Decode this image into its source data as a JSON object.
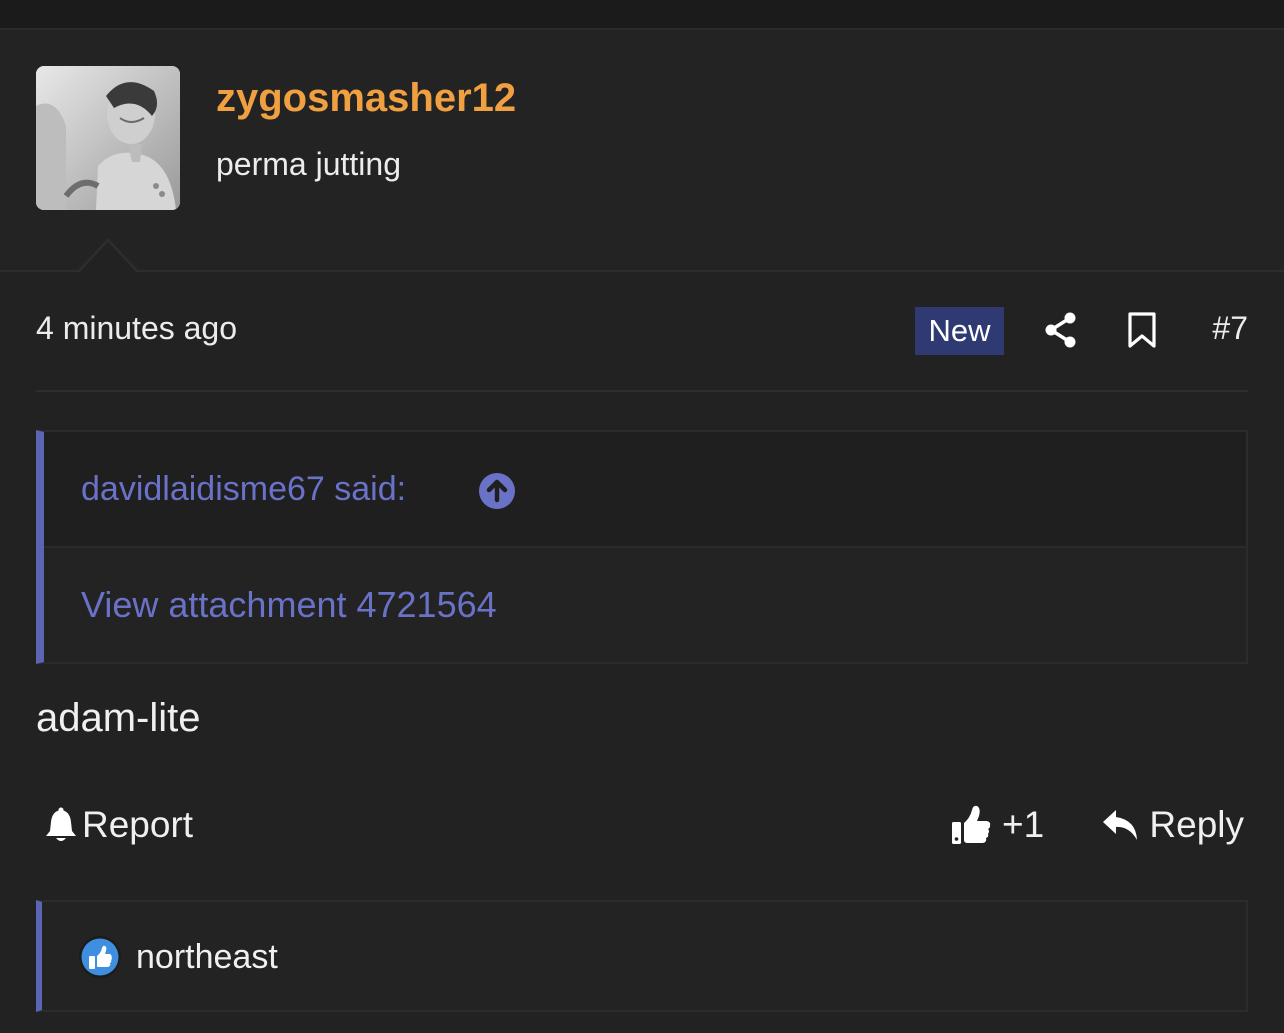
{
  "user": {
    "username": "zygosmasher12",
    "title": "perma jutting",
    "avatar": "avatar-photo"
  },
  "post": {
    "timestamp": "4 minutes ago",
    "badge": "New",
    "number": "#7",
    "text": "adam-lite"
  },
  "quote": {
    "author": "davidlaidisme67 said:",
    "body": "View attachment 4721564"
  },
  "actions": {
    "report": "Report",
    "like_count": "+1",
    "reply": "Reply"
  },
  "reactions": {
    "user": "northeast",
    "icon": "like-reaction-icon"
  },
  "icons": {
    "share": "share-icon",
    "bookmark": "bookmark-icon",
    "bell": "bell-icon",
    "thumbs_up": "thumbs-up-icon",
    "reply_arrow": "reply-arrow-icon",
    "jump": "arrow-up-circle-icon"
  },
  "colors": {
    "username": "#f0a040",
    "link": "#6a72c8",
    "badge_bg": "#2f3a72",
    "quote_border": "#5c64b4",
    "background": "#222223"
  }
}
